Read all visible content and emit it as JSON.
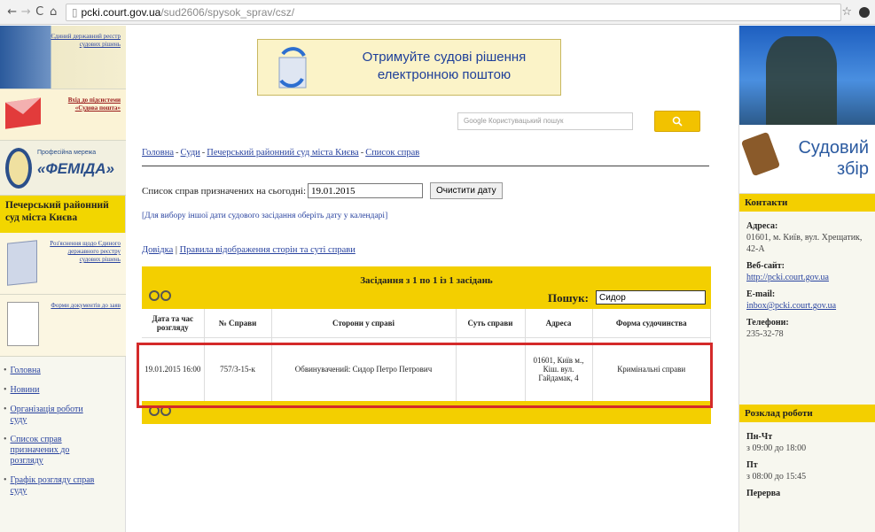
{
  "browser": {
    "url_host": "pcki.court.gov.ua",
    "url_path": "/sud2606/spysok_sprav/csz/"
  },
  "left_sidebar": {
    "ad_registry": "Єдиний державний реєстр судових рішень",
    "ad_mail": "Вхід до підсистеми «Судова пошта»",
    "ad_femida_small": "Професійна мережа",
    "ad_femida_big": "«ФЕМІДА»",
    "court_name": "Печерський районний суд міста Києва",
    "ad_book": "Роз'яснення щодо Єдиного державного реєстру судових рішень",
    "ad_forms": "Форми документів до заяв",
    "menu": [
      {
        "label": "Головна"
      },
      {
        "label": "Новини"
      },
      {
        "label": "Організація роботи суду"
      },
      {
        "label": "Список справ призначених до розгляду"
      },
      {
        "label": "Графік розгляду справ суду"
      }
    ]
  },
  "main": {
    "banner_text": "Отримуйте судові рішення електронною поштою",
    "search_placeholder": "Google Користувацький пошук",
    "breadcrumbs": [
      "Головна",
      "Суди",
      "Печерський районний суд міста Києва",
      "Список справ"
    ],
    "list_label": "Список справ призначених на сьогодні:",
    "date_value": "19.01.2015",
    "clear_button": "Очистити дату",
    "hint": "[Для вибору іншої дати судового засідання оберіть дату у календарі]",
    "link_help": "Довідка",
    "link_rules": "Правила відображення сторін та суті справи",
    "table": {
      "sessions_title": "Засідання з 1 по 1 із 1 засідань",
      "search_label": "Пошук:",
      "search_value": "Сидор",
      "headers": [
        "Дата та час розгляду",
        "№ Справи",
        "Сторони у справі",
        "Суть справи",
        "Адреса",
        "Форма судочинства"
      ],
      "rows": [
        {
          "date": "19.01.2015 16:00",
          "case_no": "757/3-15-к",
          "parties": "Обвинувачений: Сидор Петро Петрович",
          "subject": "",
          "address": "01601, Київ м., Кіш. вул. Гайдамак, 4",
          "form": "Кримінальні справи"
        }
      ]
    }
  },
  "right_sidebar": {
    "fee_line1": "Судовий",
    "fee_line2": "збір",
    "contacts_title": "Контакти",
    "address_label": "Адреса:",
    "address_value": "01601, м. Київ, вул. Хрещатик, 42-А",
    "web_label": "Веб-сайт:",
    "web_value": "http://pcki.court.gov.ua",
    "email_label": "E-mail:",
    "email_value": "inbox@pcki.court.gov.ua",
    "phone_label": "Телефони:",
    "phone_value": "235-32-78",
    "schedule_title": "Розклад роботи",
    "schedule": [
      {
        "day": "Пн-Чт",
        "time": "з 09:00 до 18:00"
      },
      {
        "day": "Пт",
        "time": "з 08:00 до 15:45"
      },
      {
        "day": "Перерва",
        "time": ""
      }
    ]
  }
}
